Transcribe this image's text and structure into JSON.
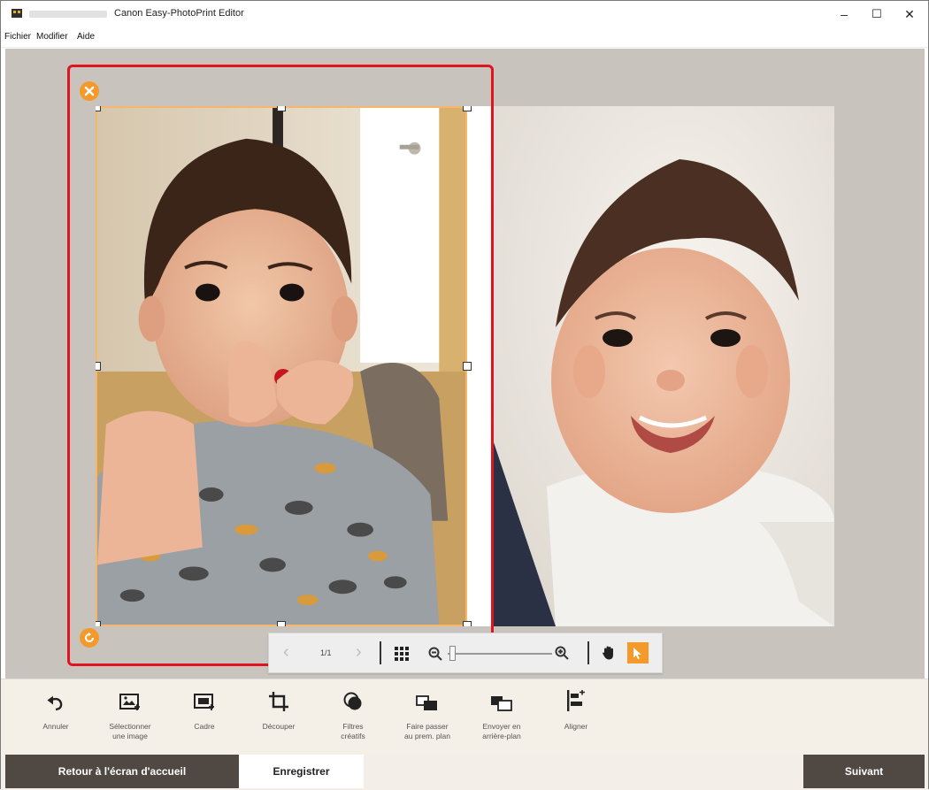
{
  "window": {
    "title": "Canon Easy-PhotoPrint Editor",
    "controls": {
      "minimize": "–",
      "maximize": "☐",
      "close": "✕"
    }
  },
  "menu": {
    "items": [
      "Fichier",
      "Modifier",
      "Aide"
    ]
  },
  "navigator": {
    "page_count": "1/1",
    "prev": "‹",
    "next": "›"
  },
  "toolbar": {
    "items": [
      {
        "label": "Annuler",
        "icon": "undo-icon"
      },
      {
        "label": "Sélectionner\nune image",
        "icon": "select-image-icon"
      },
      {
        "label": "Cadre",
        "icon": "frame-icon"
      },
      {
        "label": "Découper",
        "icon": "crop-icon"
      },
      {
        "label": "Filtres\ncréatifs",
        "icon": "creative-filters-icon"
      },
      {
        "label": "Faire passer\nau prem. plan",
        "icon": "bring-to-front-icon"
      },
      {
        "label": "Envoyer en\narrière-plan",
        "icon": "send-to-back-icon"
      },
      {
        "label": "Aligner",
        "icon": "align-icon"
      }
    ]
  },
  "bottom": {
    "back_label": "Retour à l'écran d'accueil",
    "save_label": "Enregistrer",
    "next_label": "Suivant"
  },
  "colors": {
    "accent": "#f39a2a",
    "selection_outline": "#e0141e",
    "canvas_bg": "#c8c4bd",
    "dark_button": "#4f4843",
    "toolbar_bg": "#f4efe7"
  }
}
